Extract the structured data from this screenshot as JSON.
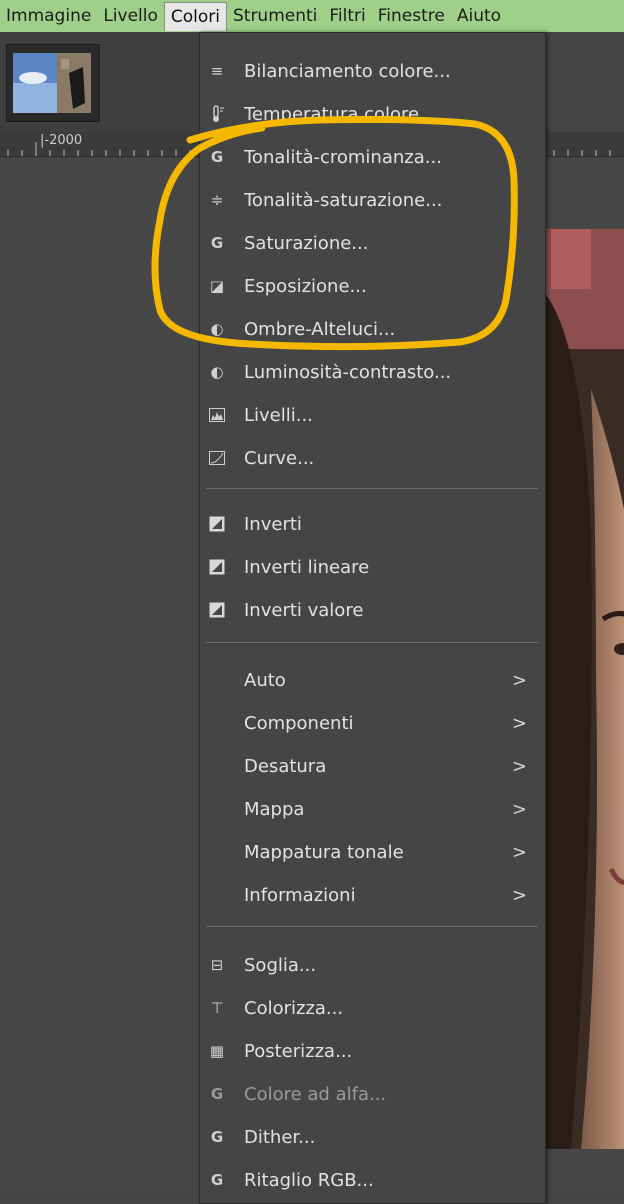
{
  "menubar": {
    "items": [
      "Immagine",
      "Livello",
      "Colori",
      "Strumenti",
      "Filtri",
      "Finestre",
      "Aiuto"
    ],
    "active": "Colori"
  },
  "ruler": {
    "label": "|-2000"
  },
  "menu": {
    "group1": [
      {
        "label": "Bilanciamento colore...",
        "icon": "color-balance-icon",
        "glyph": "≡"
      },
      {
        "label": "Temperatura colore...",
        "icon": "thermometer-icon",
        "glyph": "🌡"
      },
      {
        "label": "Tonalità-crominanza...",
        "icon": "gegl-icon",
        "glyph": "G"
      },
      {
        "label": "Tonalità-saturazione...",
        "icon": "hue-saturation-icon",
        "glyph": "≑"
      },
      {
        "label": "Saturazione...",
        "icon": "gegl-icon",
        "glyph": "G"
      },
      {
        "label": "Esposizione...",
        "icon": "exposure-icon",
        "glyph": "◪"
      },
      {
        "label": "Ombre-Alteluci...",
        "icon": "shadows-highlights-icon",
        "glyph": "◐"
      },
      {
        "label": "Luminosità-contrasto...",
        "icon": "brightness-contrast-icon",
        "glyph": "◐"
      },
      {
        "label": "Livelli...",
        "icon": "levels-icon",
        "glyph": "▤"
      },
      {
        "label": "Curve...",
        "icon": "curves-icon",
        "glyph": "◺"
      }
    ],
    "group2": [
      {
        "label": "Inverti",
        "icon": "invert-icon"
      },
      {
        "label": "Inverti lineare",
        "icon": "invert-icon"
      },
      {
        "label": "Inverti valore",
        "icon": "invert-icon"
      }
    ],
    "group3": [
      {
        "label": "Auto"
      },
      {
        "label": "Componenti"
      },
      {
        "label": "Desatura"
      },
      {
        "label": "Mappa"
      },
      {
        "label": "Mappatura tonale"
      },
      {
        "label": "Informazioni"
      }
    ],
    "group4": [
      {
        "label": "Soglia...",
        "icon": "threshold-icon",
        "glyph": "⊟"
      },
      {
        "label": "Colorizza...",
        "icon": "colorize-icon",
        "glyph": "⊤"
      },
      {
        "label": "Posterizza...",
        "icon": "posterize-icon",
        "glyph": "▦"
      },
      {
        "label": "Colore ad alfa...",
        "icon": "gegl-icon",
        "glyph": "G",
        "disabled": true
      },
      {
        "label": "Dither...",
        "icon": "gegl-icon",
        "glyph": "G"
      },
      {
        "label": "Ritaglio RGB...",
        "icon": "gegl-icon",
        "glyph": "G"
      }
    ],
    "submenu_arrow": ">"
  },
  "colors": {
    "menubar_bg": "#9fd08a",
    "menu_bg": "#454545",
    "annotation": "#f5b800"
  }
}
